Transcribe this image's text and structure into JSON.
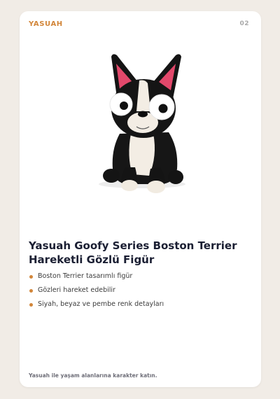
{
  "header": {
    "brand": "YASUAH",
    "page_number": "02"
  },
  "product": {
    "image_alt": "Boston Terrier figure with googly eyes",
    "title": "Yasuah Goofy Series Boston Terrier Hareketli Gözlü Figür",
    "features": [
      "Boston Terrier tasarımlı figür",
      "Gözleri hareket edebilir",
      "Siyah, beyaz ve pembe renk detayları"
    ]
  },
  "footer": {
    "tagline": "Yasuah ile yaşam alanlarına karakter katın."
  },
  "colors": {
    "accent": "#d2863a",
    "background": "#f1ece6",
    "card": "#ffffff",
    "title": "#1b1f33"
  }
}
